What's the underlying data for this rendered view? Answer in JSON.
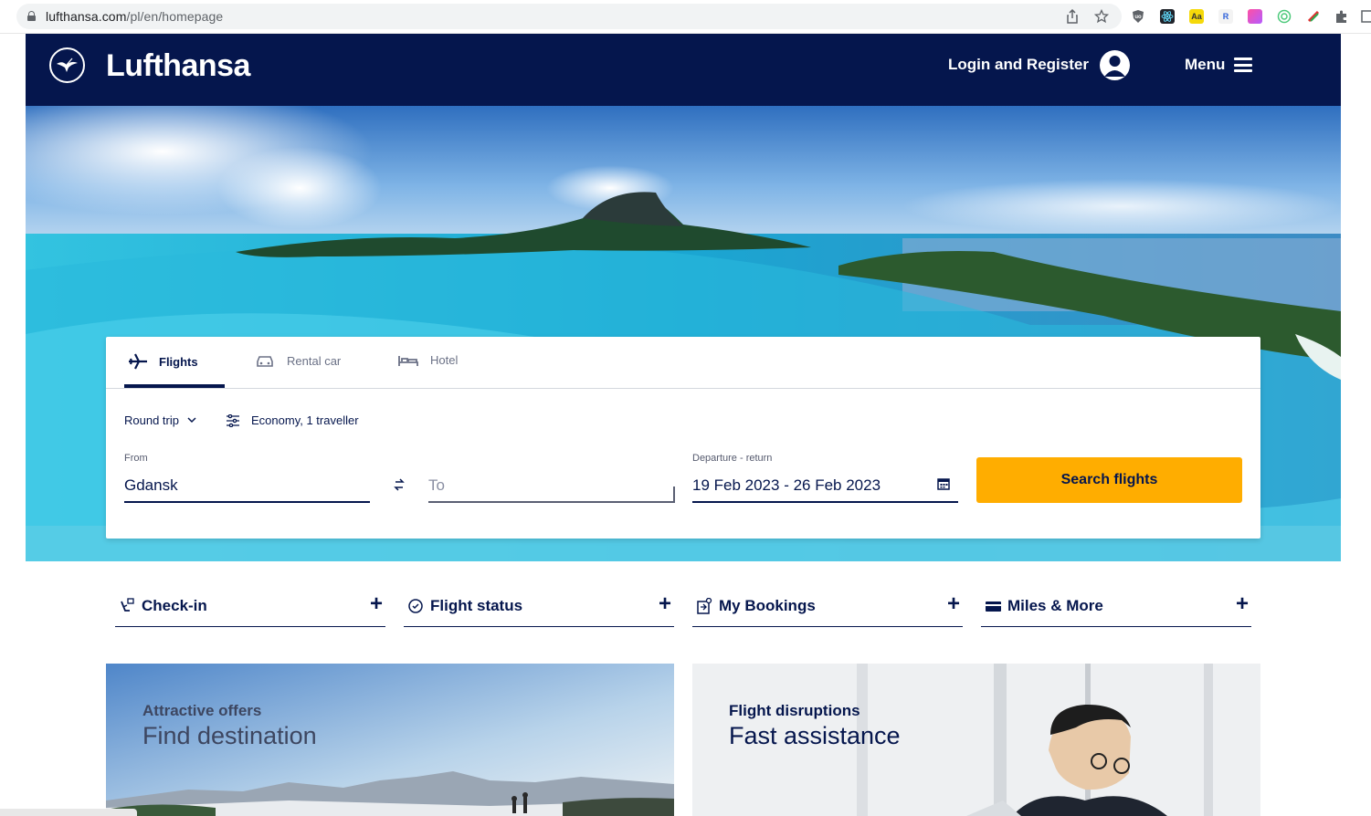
{
  "browser": {
    "url_host": "lufthansa.com",
    "url_path": "/pl/en/homepage"
  },
  "header": {
    "brand": "Lufthansa",
    "login_label": "Login and Register",
    "menu_label": "Menu"
  },
  "booking": {
    "tabs": [
      {
        "label": "Flights",
        "active": true
      },
      {
        "label": "Rental car",
        "active": false
      },
      {
        "label": "Hotel",
        "active": false
      }
    ],
    "trip_type": "Round trip",
    "cabin_travellers": "Economy, 1 traveller",
    "from_label": "From",
    "from_value": "Gdansk",
    "to_placeholder": "To",
    "dates_label": "Departure - return",
    "dates_value": "19 Feb 2023 - 26 Feb 2023",
    "search_label": "Search flights"
  },
  "quick_links": [
    {
      "label": "Check-in",
      "icon": "check-in-icon"
    },
    {
      "label": "Flight status",
      "icon": "flight-status-icon"
    },
    {
      "label": "My Bookings",
      "icon": "my-bookings-icon"
    },
    {
      "label": "Miles & More",
      "icon": "miles-card-icon"
    }
  ],
  "teasers": [
    {
      "kicker": "Attractive offers",
      "headline": "Find destination"
    },
    {
      "kicker": "Flight disruptions",
      "headline": "Fast assistance"
    }
  ],
  "colors": {
    "brand_navy": "#05164d",
    "cta_yellow": "#ffad00"
  }
}
